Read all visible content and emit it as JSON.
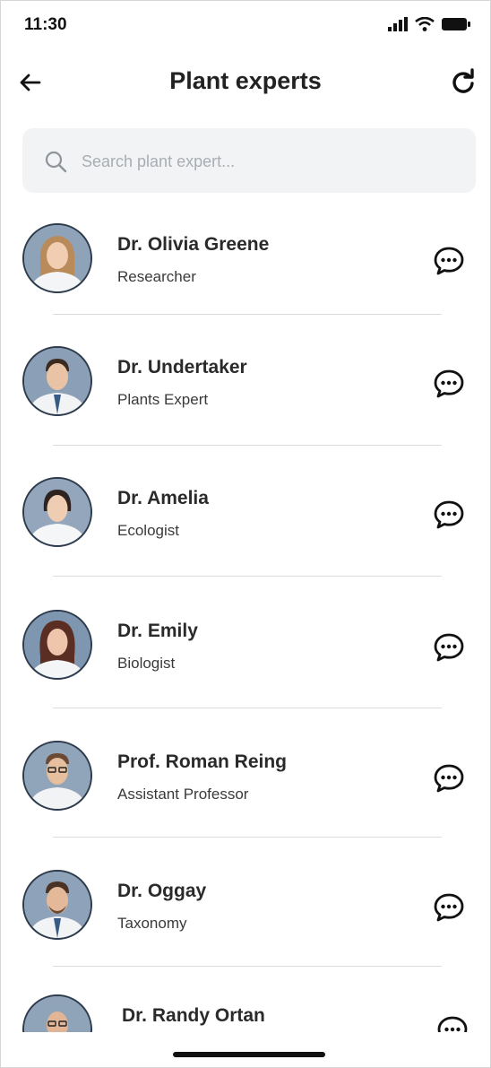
{
  "status_bar": {
    "time": "11:30",
    "icons": [
      "signal-icon",
      "wifi-icon",
      "battery-icon"
    ]
  },
  "header": {
    "title": "Plant experts",
    "back_icon": "arrow-left-icon",
    "refresh_icon": "refresh-icon"
  },
  "search": {
    "placeholder": "Search plant expert...",
    "value": "",
    "icon": "search-icon"
  },
  "experts": [
    {
      "name": "Dr. Olivia Greene",
      "role": "Researcher"
    },
    {
      "name": "Dr. Undertaker",
      "role": "Plants Expert"
    },
    {
      "name": "Dr. Amelia",
      "role": "Ecologist"
    },
    {
      "name": "Dr. Emily",
      "role": "Biologist"
    },
    {
      "name": "Prof. Roman Reing",
      "role": "Assistant Professor"
    },
    {
      "name": "Dr. Oggay",
      "role": "Taxonomy"
    },
    {
      "name": "Dr. Randy Ortan",
      "role": ""
    }
  ],
  "colors": {
    "search_bg": "#f2f3f4",
    "divider": "#d9dcdf",
    "avatar_border": "#2d3b4c",
    "text": "#2a2a2a"
  }
}
